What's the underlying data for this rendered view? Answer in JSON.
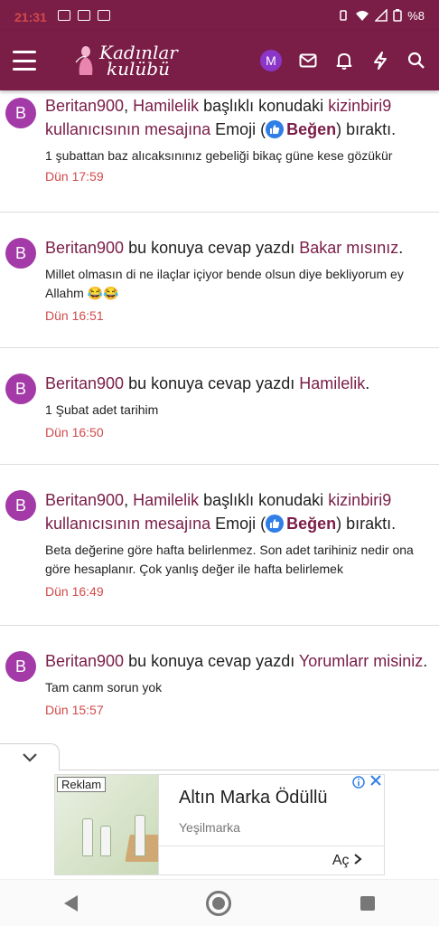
{
  "status": {
    "time": "21:31",
    "battery": "%8"
  },
  "header": {
    "logo_line1": "Kadınlar",
    "logo_line2": "kulübü",
    "avatar_letter": "M"
  },
  "feed": [
    {
      "avatar": "B",
      "user": "Beritan900",
      "t1": ", ",
      "thread": "Hamilelik",
      "t2": " başlıklı konudaki ",
      "target": "kizinbiri9 kullanıcısının mesajına",
      "t3": " Emoji (",
      "reaction": "Beğen",
      "t4": ") bıraktı.",
      "snippet": "1 şubattan baz alıcaksınınız gebeliği bikaç güne kese gözükür",
      "time": "Dün 17:59"
    },
    {
      "avatar": "B",
      "user": "Beritan900",
      "t1": " bu konuya cevap yazdı ",
      "thread": "Bakar mısınız",
      "t2": ".",
      "snippet": "Millet olmasın di ne ilaçlar içiyor bende olsun diye bekliyorum ey Allahm 😂😂",
      "time": "Dün 16:51"
    },
    {
      "avatar": "B",
      "user": "Beritan900",
      "t1": " bu konuya cevap yazdı ",
      "thread": "Hamilelik",
      "t2": ".",
      "snippet": "1 Şubat adet tarihim",
      "time": "Dün 16:50"
    },
    {
      "avatar": "B",
      "user": "Beritan900",
      "t1": ", ",
      "thread": "Hamilelik",
      "t2": " başlıklı konudaki ",
      "target": "kizinbiri9 kullanıcısının mesajına",
      "t3": " Emoji (",
      "reaction": "Beğen",
      "t4": ") bıraktı.",
      "snippet": "Beta değerine göre hafta belirlenmez. Son adet tarihiniz nedir ona göre hesaplanır. Çok yanlış değer ile hafta belirlemek",
      "time": "Dün 16:49"
    },
    {
      "avatar": "B",
      "user": "Beritan900",
      "t1": " bu konuya cevap yazdı ",
      "thread": "Yorumlarr misiniz",
      "t2": ".",
      "snippet": "Tam canm sorun yok",
      "time": "Dün 15:57"
    }
  ],
  "ad": {
    "tag": "Reklam",
    "title": "Altın Marka Ödüllü",
    "advertiser": "Yeşilmarka",
    "cta": "Aç"
  }
}
